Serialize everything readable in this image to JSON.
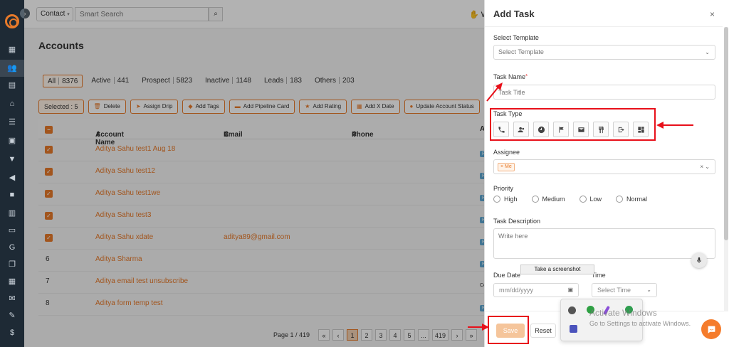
{
  "topbar": {
    "contact_filter": "Contact",
    "search_placeholder": "Smart Search",
    "right_label": "W"
  },
  "page": {
    "title": "Accounts"
  },
  "filters": [
    {
      "label": "All",
      "count": "8376"
    },
    {
      "label": "Active",
      "count": "441"
    },
    {
      "label": "Prospect",
      "count": "5823"
    },
    {
      "label": "Inactive",
      "count": "1148"
    },
    {
      "label": "Leads",
      "count": "183"
    },
    {
      "label": "Others",
      "count": "203"
    }
  ],
  "actions": {
    "selected": "Selected : 5",
    "buttons": [
      "Delete",
      "Assign Drip",
      "Add Tags",
      "Add Pipeline Card",
      "Add Rating",
      "Add X Date",
      "Update Account Status"
    ]
  },
  "table": {
    "headers": {
      "name": "Account Name",
      "email": "Email",
      "phone": "Phone",
      "type": "Account T"
    },
    "rows": [
      {
        "num": "",
        "checked": true,
        "name": "Aditya Sahu test1 Aug 18",
        "email": "",
        "type": "Personal"
      },
      {
        "num": "",
        "checked": true,
        "name": "Aditya Sahu test12",
        "email": "",
        "type": "Personal"
      },
      {
        "num": "",
        "checked": true,
        "name": "Aditya Sahu test1we",
        "email": "",
        "type": "Personal"
      },
      {
        "num": "",
        "checked": true,
        "name": "Aditya Sahu test3",
        "email": "",
        "type": "Personal"
      },
      {
        "num": "",
        "checked": true,
        "name": "Aditya Sahu xdate",
        "email": "aditya89@gmail.com",
        "type": "Personal"
      },
      {
        "num": "6",
        "checked": false,
        "name": "Aditya Sharma",
        "email": "",
        "type": "Personal"
      },
      {
        "num": "7",
        "checked": false,
        "name": "Aditya email test unsubscribe",
        "email": "",
        "type": "Commercial"
      },
      {
        "num": "8",
        "checked": false,
        "name": "Aditya form temp test",
        "email": "",
        "type": "Personal"
      }
    ]
  },
  "pagination": {
    "label": "Page 1 / 419",
    "first": "«",
    "prev": "‹",
    "pages": [
      "1",
      "2",
      "3",
      "4",
      "5",
      "...",
      "419"
    ],
    "next": "›",
    "last": "»"
  },
  "modal": {
    "title": "Add Task",
    "close": "×",
    "template_label": "Select Template",
    "template_value": "Select Template",
    "task_name_label": "Task Name",
    "task_name_required": "*",
    "task_name_placeholder": "Task Title",
    "task_type_label": "Task Type",
    "task_types": [
      "phone-icon",
      "meeting-icon",
      "clock-icon",
      "flag-icon",
      "email-icon",
      "utensils-icon",
      "export-icon",
      "dashboard-icon"
    ],
    "assignee_label": "Assignee",
    "assignee_tag": "Me",
    "assignee_tag_remove": "×",
    "priority_label": "Priority",
    "priorities": [
      "High",
      "Medium",
      "Low",
      "Normal"
    ],
    "description_label": "Task Description",
    "description_placeholder": "Write here",
    "due_date_label": "Due Date",
    "due_date_placeholder": "mm/dd/yyyy",
    "time_label": "Time",
    "time_placeholder": "Select Time",
    "save": "Save",
    "reset": "Reset"
  },
  "overlay_tip": "Take a screenshot",
  "watermark": {
    "line1": "Activate Windows",
    "line2": "Go to Settings to activate Windows."
  },
  "colors": {
    "accent": "#e87a2a",
    "sidebar": "#1e2a35",
    "annotation_red": "#e8101a"
  }
}
